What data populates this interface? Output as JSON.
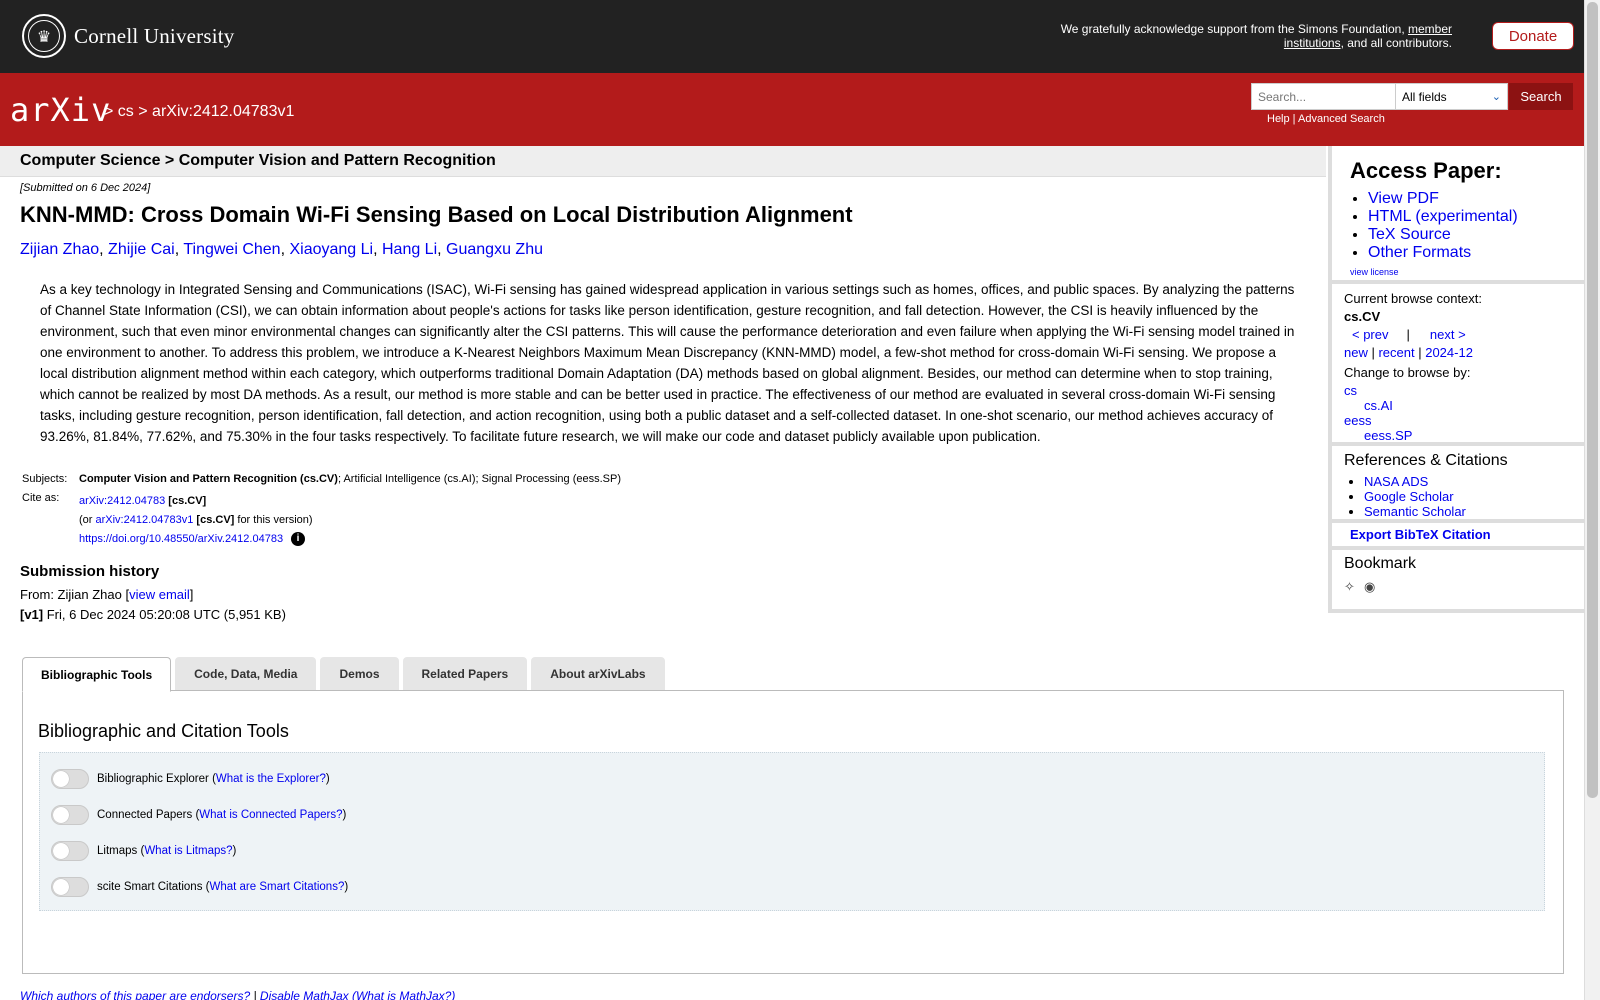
{
  "banner": {
    "institution": "Cornell University",
    "ack_text": "We gratefully acknowledge support from the Simons Foundation, ",
    "ack_link": "member institutions",
    "ack_tail": ", and all contributors.",
    "donate": "Donate"
  },
  "header": {
    "logo": "arXiv",
    "crumb_sep1": ">",
    "crumb_cs": "cs",
    "crumb_sep2": ">",
    "crumb_id": "arXiv:2412.04783v1",
    "search_placeholder": "Search...",
    "search_field": "All fields",
    "search_button": "Search",
    "help": "Help",
    "help_sep": " | ",
    "advanced": "Advanced Search"
  },
  "category_bar": "Computer Science > Computer Vision and Pattern Recognition",
  "paper": {
    "submitted": "[Submitted on 6 Dec 2024]",
    "title": "KNN-MMD: Cross Domain Wi-Fi Sensing Based on Local Distribution Alignment",
    "authors": [
      "Zijian Zhao",
      "Zhijie Cai",
      "Tingwei Chen",
      "Xiaoyang Li",
      "Hang Li",
      "Guangxu Zhu"
    ],
    "abstract": "As a key technology in Integrated Sensing and Communications (ISAC), Wi-Fi sensing has gained widespread application in various settings such as homes, offices, and public spaces. By analyzing the patterns of Channel State Information (CSI), we can obtain information about people's actions for tasks like person identification, gesture recognition, and fall detection. However, the CSI is heavily influenced by the environment, such that even minor environmental changes can significantly alter the CSI patterns. This will cause the performance deterioration and even failure when applying the Wi-Fi sensing model trained in one environment to another. To address this problem, we introduce a K-Nearest Neighbors Maximum Mean Discrepancy (KNN-MMD) model, a few-shot method for cross-domain Wi-Fi sensing. We propose a local distribution alignment method within each category, which outperforms traditional Domain Adaptation (DA) methods based on global alignment. Besides, our method can determine when to stop training, which cannot be realized by most DA methods. As a result, our method is more stable and can be better used in practice. The effectiveness of our method are evaluated in several cross-domain Wi-Fi sensing tasks, including gesture recognition, person identification, fall detection, and action recognition, using both a public dataset and a self-collected dataset. In one-shot scenario, our method achieves accuracy of 93.26%, 81.84%, 77.62%, and 75.30% in the four tasks respectively. To facilitate future research, we will make our code and dataset publicly available upon publication."
  },
  "meta": {
    "subjects_label": "Subjects:",
    "subjects_primary": "Computer Vision and Pattern Recognition (cs.CV)",
    "subjects_rest": "; Artificial Intelligence (cs.AI); Signal Processing (eess.SP)",
    "cite_label": "Cite as:",
    "cite_id": "arXiv:2412.04783",
    "cite_cat": "[cs.CV]",
    "cite_or": "(or ",
    "cite_version_id": "arXiv:2412.04783v1",
    "cite_version_tail": " for this version)",
    "doi": "https://doi.org/10.48550/arXiv.2412.04783"
  },
  "history": {
    "heading": "Submission history",
    "from_prefix": "From: Zijian Zhao [",
    "view_email": "view email",
    "from_suffix": "]",
    "version_tag": "[v1]",
    "version_text": " Fri, 6 Dec 2024 05:20:08 UTC (5,951 KB)"
  },
  "tabs": [
    "Bibliographic Tools",
    "Code, Data, Media",
    "Demos",
    "Related Papers",
    "About arXivLabs"
  ],
  "panel": {
    "heading": "Bibliographic and Citation Tools",
    "tools": [
      {
        "label": "Bibliographic Explorer",
        "link": "What is the Explorer?"
      },
      {
        "label": "Connected Papers",
        "link": "What is Connected Papers?"
      },
      {
        "label": "Litmaps",
        "link": "What is Litmaps?"
      },
      {
        "label": "scite Smart Citations",
        "link": "What are Smart Citations?"
      }
    ]
  },
  "bottom": {
    "endorsers": "Which authors of this paper are endorsers?",
    "sep": " | ",
    "disable_mathjax": "Disable MathJax",
    "what_mathjax": "(What is MathJax?)"
  },
  "sidebar": {
    "access_heading": "Access Paper:",
    "access_links": [
      "View PDF",
      "HTML (experimental)",
      "TeX Source",
      "Other Formats"
    ],
    "view_license": "view license",
    "context_label": "Current browse context:",
    "context_value": "cs.CV",
    "prev": "< prev",
    "pipe": "|",
    "next": "next >",
    "new": "new",
    "recent": "recent",
    "month": "2024-12",
    "change_label": "Change to browse by:",
    "browse_cats": [
      {
        "name": "cs",
        "indent": false
      },
      {
        "name": "cs.AI",
        "indent": true
      },
      {
        "name": "eess",
        "indent": false
      },
      {
        "name": "eess.SP",
        "indent": true
      }
    ],
    "refs_heading": "References & Citations",
    "refs_links": [
      "NASA ADS",
      "Google Scholar",
      "Semantic Scholar"
    ],
    "bibtex": "Export BibTeX Citation",
    "bookmark_heading": "Bookmark",
    "bookmark_icons": [
      "bibsonomy-icon",
      "reddit-icon"
    ]
  },
  "colors": {
    "arxiv_red": "#b31b1b",
    "banner_dark": "#222222",
    "link_blue": "#0000ee"
  }
}
